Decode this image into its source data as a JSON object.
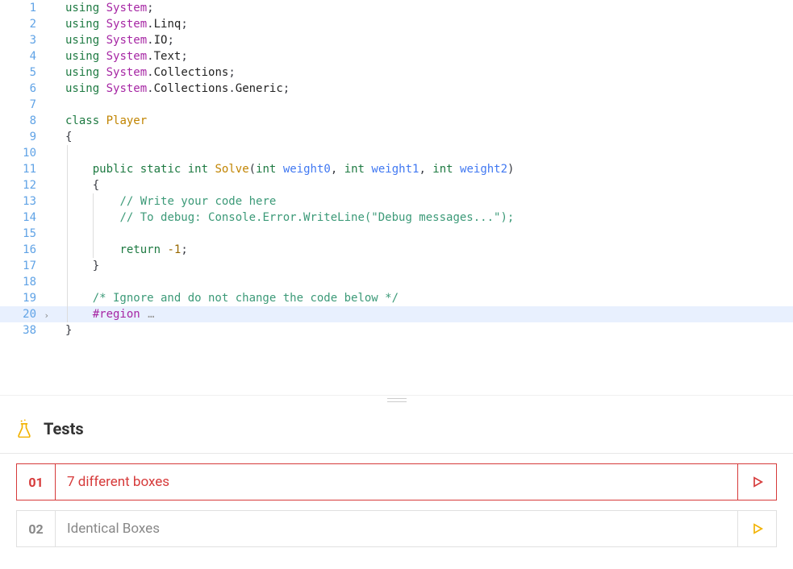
{
  "code": {
    "lines": [
      {
        "n": 1,
        "tokens": [
          [
            "kw1",
            "using"
          ],
          [
            "punc",
            " "
          ],
          [
            "pkg",
            "System"
          ],
          [
            "punc",
            ";"
          ]
        ]
      },
      {
        "n": 2,
        "tokens": [
          [
            "kw1",
            "using"
          ],
          [
            "punc",
            " "
          ],
          [
            "pkg",
            "System"
          ],
          [
            "punc",
            "."
          ],
          [
            "ns",
            "Linq"
          ],
          [
            "punc",
            ";"
          ]
        ]
      },
      {
        "n": 3,
        "tokens": [
          [
            "kw1",
            "using"
          ],
          [
            "punc",
            " "
          ],
          [
            "pkg",
            "System"
          ],
          [
            "punc",
            "."
          ],
          [
            "ns",
            "IO"
          ],
          [
            "punc",
            ";"
          ]
        ]
      },
      {
        "n": 4,
        "tokens": [
          [
            "kw1",
            "using"
          ],
          [
            "punc",
            " "
          ],
          [
            "pkg",
            "System"
          ],
          [
            "punc",
            "."
          ],
          [
            "ns",
            "Text"
          ],
          [
            "punc",
            ";"
          ]
        ]
      },
      {
        "n": 5,
        "tokens": [
          [
            "kw1",
            "using"
          ],
          [
            "punc",
            " "
          ],
          [
            "pkg",
            "System"
          ],
          [
            "punc",
            "."
          ],
          [
            "ns",
            "Collections"
          ],
          [
            "punc",
            ";"
          ]
        ]
      },
      {
        "n": 6,
        "tokens": [
          [
            "kw1",
            "using"
          ],
          [
            "punc",
            " "
          ],
          [
            "pkg",
            "System"
          ],
          [
            "punc",
            "."
          ],
          [
            "ns",
            "Collections"
          ],
          [
            "punc",
            "."
          ],
          [
            "ns",
            "Generic"
          ],
          [
            "punc",
            ";"
          ]
        ]
      },
      {
        "n": 7,
        "tokens": []
      },
      {
        "n": 8,
        "tokens": [
          [
            "kw1",
            "class"
          ],
          [
            "punc",
            " "
          ],
          [
            "cls",
            "Player"
          ]
        ]
      },
      {
        "n": 9,
        "tokens": [
          [
            "punc",
            "{"
          ]
        ]
      },
      {
        "n": 10,
        "tokens": [],
        "indent": 1
      },
      {
        "n": 11,
        "tokens": [
          [
            "kw1",
            "public"
          ],
          [
            "punc",
            " "
          ],
          [
            "kw1",
            "static"
          ],
          [
            "punc",
            " "
          ],
          [
            "kw1",
            "int"
          ],
          [
            "punc",
            " "
          ],
          [
            "cls",
            "Solve"
          ],
          [
            "punc",
            "("
          ],
          [
            "kw1",
            "int"
          ],
          [
            "punc",
            " "
          ],
          [
            "name",
            "weight0"
          ],
          [
            "punc",
            ", "
          ],
          [
            "kw1",
            "int"
          ],
          [
            "punc",
            " "
          ],
          [
            "name",
            "weight1"
          ],
          [
            "punc",
            ", "
          ],
          [
            "kw1",
            "int"
          ],
          [
            "punc",
            " "
          ],
          [
            "name",
            "weight2"
          ],
          [
            "punc",
            ")"
          ]
        ],
        "indent": 1
      },
      {
        "n": 12,
        "tokens": [
          [
            "punc",
            "{"
          ]
        ],
        "indent": 1
      },
      {
        "n": 13,
        "tokens": [
          [
            "cmtgreen",
            "// Write your code here"
          ]
        ],
        "indent": 2
      },
      {
        "n": 14,
        "tokens": [
          [
            "cmtgreen",
            "// To debug: Console.Error.WriteLine(\"Debug messages...\");"
          ]
        ],
        "indent": 2
      },
      {
        "n": 15,
        "tokens": [],
        "indent": 2
      },
      {
        "n": 16,
        "tokens": [
          [
            "kw1",
            "return"
          ],
          [
            "punc",
            " "
          ],
          [
            "num",
            "-1"
          ],
          [
            "punc",
            ";"
          ]
        ],
        "indent": 2
      },
      {
        "n": 17,
        "tokens": [
          [
            "punc",
            "}"
          ]
        ],
        "indent": 1
      },
      {
        "n": 18,
        "tokens": [],
        "indent": 1
      },
      {
        "n": 19,
        "tokens": [
          [
            "cmtgreen",
            "/* Ignore and do not change the code below */"
          ]
        ],
        "indent": 1
      },
      {
        "n": 20,
        "tokens": [
          [
            "region",
            "#region"
          ],
          [
            "fold-dots",
            " …"
          ]
        ],
        "indent": 1,
        "highlighted": true,
        "folded": true
      },
      {
        "n": 38,
        "tokens": [
          [
            "punc",
            "}"
          ]
        ]
      }
    ]
  },
  "tests": {
    "title": "Tests",
    "items": [
      {
        "num": "01",
        "label": "7 different boxes",
        "active": true,
        "play": "red"
      },
      {
        "num": "02",
        "label": "Identical Boxes",
        "active": false,
        "play": "yellow"
      }
    ]
  }
}
